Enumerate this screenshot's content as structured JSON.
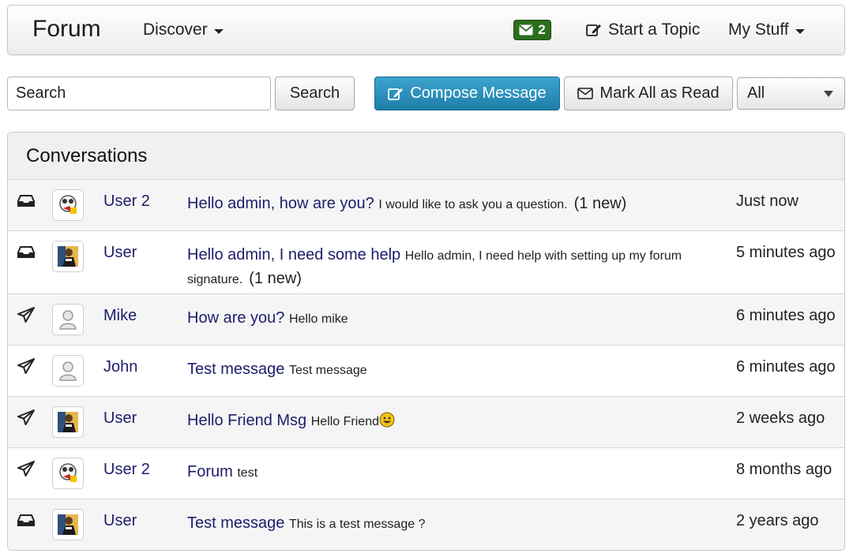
{
  "navbar": {
    "brand": "Forum",
    "discover_label": "Discover",
    "messages_count": "2",
    "start_topic_label": "Start a Topic",
    "my_stuff_label": "My Stuff"
  },
  "toolbar": {
    "search_placeholder": "Search",
    "search_button": "Search",
    "compose_button": "Compose Message",
    "mark_all_button": "Mark All as Read",
    "filter_selected": "All"
  },
  "conversations": {
    "heading": "Conversations",
    "rows": [
      {
        "direction_icon": "inbox-icon",
        "avatar": "avatar-user2",
        "user": "User 2",
        "subject": "Hello admin, how are you?",
        "preview": "I would like to ask you a question.",
        "new": "(1 new)",
        "time": "Just now"
      },
      {
        "direction_icon": "inbox-icon",
        "avatar": "avatar-user",
        "user": "User",
        "subject": "Hello admin, I need some help",
        "preview": "Hello admin, I need help with setting up my forum signature.",
        "new": "(1 new)",
        "time": "5 minutes ago"
      },
      {
        "direction_icon": "sent-icon",
        "avatar": "avatar-default",
        "user": "Mike",
        "subject": "How are you?",
        "preview": "Hello mike",
        "new": "",
        "time": "6 minutes ago"
      },
      {
        "direction_icon": "sent-icon",
        "avatar": "avatar-default",
        "user": "John",
        "subject": "Test message",
        "preview": "Test message",
        "new": "",
        "time": "6 minutes ago"
      },
      {
        "direction_icon": "sent-icon",
        "avatar": "avatar-user",
        "user": "User",
        "subject": "Hello Friend Msg",
        "preview": "Hello Friend",
        "new": "",
        "time": "2 weeks ago"
      },
      {
        "direction_icon": "sent-icon",
        "avatar": "avatar-user2",
        "user": "User 2",
        "subject": "Forum",
        "preview": "test",
        "new": "",
        "time": "8 months ago"
      },
      {
        "direction_icon": "inbox-icon",
        "avatar": "avatar-user",
        "user": "User",
        "subject": "Test message",
        "preview": "This is a test message ?",
        "new": "",
        "time": "2 years ago"
      }
    ]
  },
  "colors": {
    "link": "#1d1d6b",
    "compose_bg": "#2a8fbd",
    "badge_bg": "#2d6e1e"
  }
}
